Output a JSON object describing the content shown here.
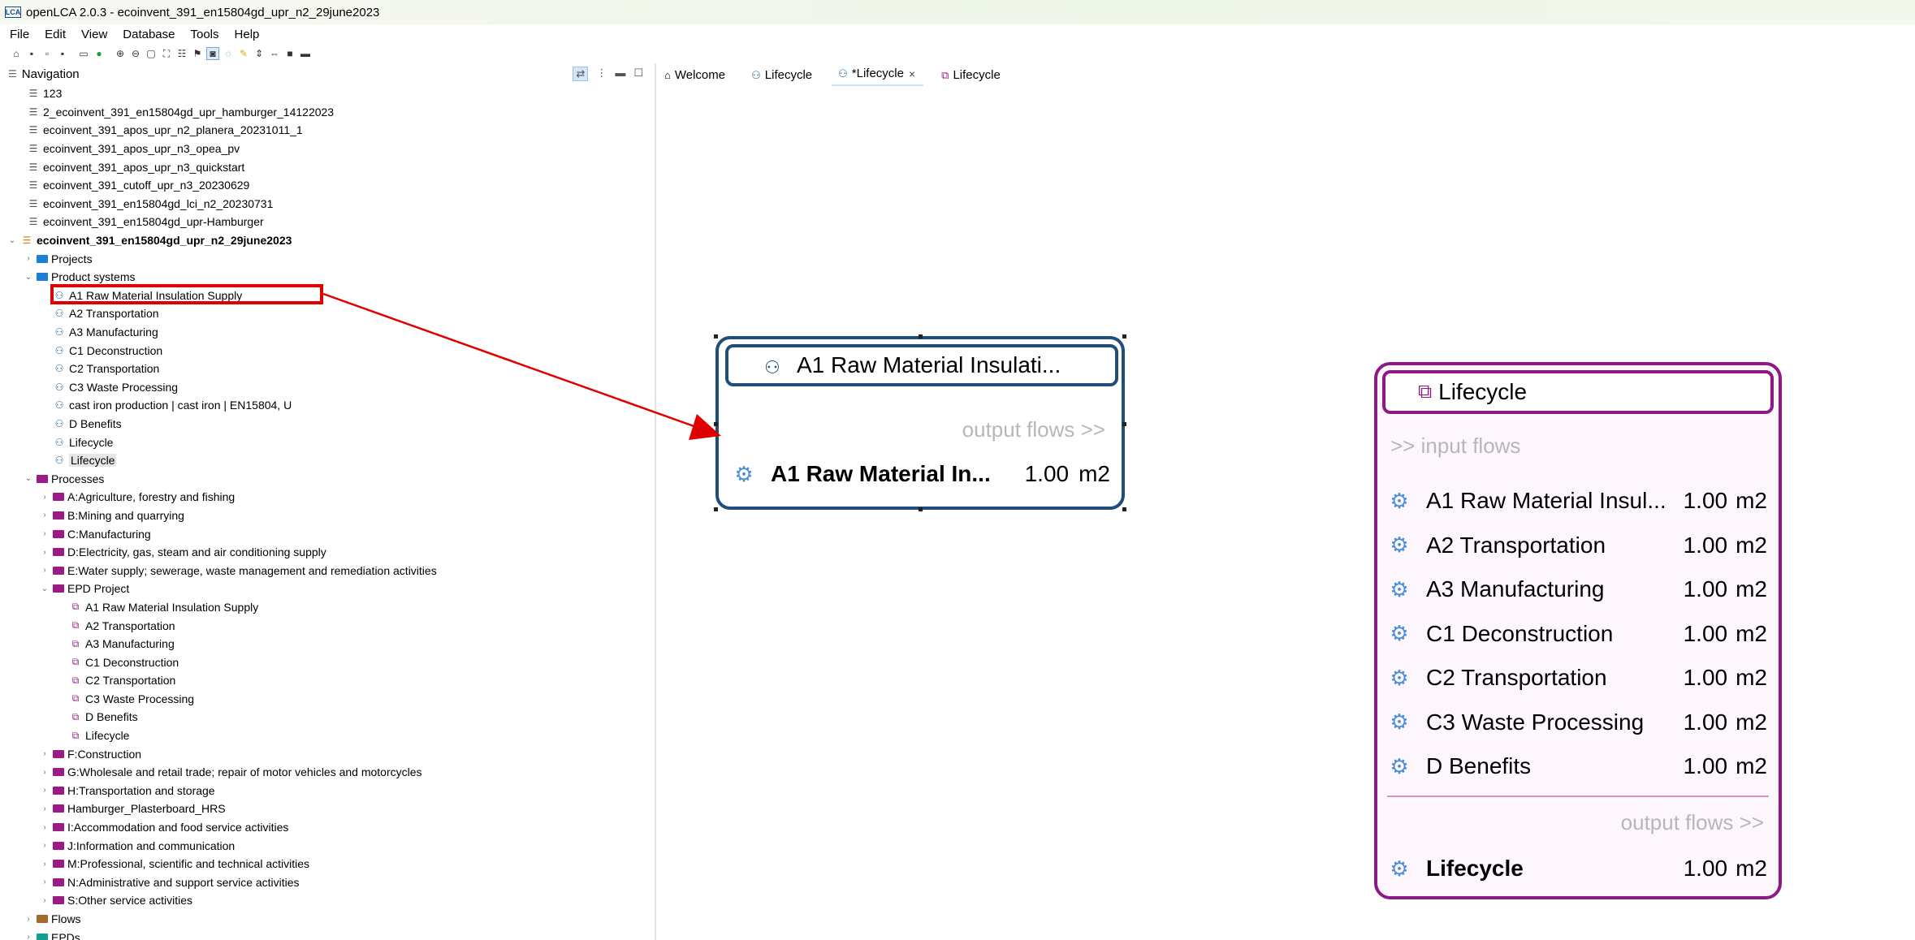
{
  "window": {
    "title": "openLCA 2.0.3 - ecoinvent_391_en15804gd_upr_n2_29june2023",
    "app_icon": "LCA"
  },
  "menu": [
    "File",
    "Edit",
    "View",
    "Database",
    "Tools",
    "Help"
  ],
  "navigation": {
    "header": "Navigation",
    "databases_top": [
      "123",
      "2_ecoinvent_391_en15804gd_upr_hamburger_14122023",
      "ecoinvent_391_apos_upr_n2_planera_20231011_1",
      "ecoinvent_391_apos_upr_n3_opea_pv",
      "ecoinvent_391_apos_upr_n3_quickstart",
      "ecoinvent_391_cutoff_upr_n3_20230629",
      "ecoinvent_391_en15804gd_lci_n2_20230731",
      "ecoinvent_391_en15804gd_upr-Hamburger"
    ],
    "active_db": "ecoinvent_391_en15804gd_upr_n2_29june2023",
    "projects": "Projects",
    "product_systems_label": "Product systems",
    "product_systems": [
      "A1 Raw Material Insulation Supply",
      "A2 Transportation",
      "A3 Manufacturing",
      "C1 Deconstruction",
      "C2 Transportation",
      "C3 Waste Processing",
      "cast iron production | cast iron | EN15804, U",
      "D Benefits",
      "Lifecycle",
      "Lifecycle"
    ],
    "processes_label": "Processes",
    "process_folders_a": [
      "A:Agriculture, forestry and fishing",
      "B:Mining and quarrying",
      "C:Manufacturing",
      "D:Electricity, gas, steam and air conditioning supply",
      "E:Water supply; sewerage, waste management and remediation activities"
    ],
    "epd_folder": "EPD Project",
    "epd_processes": [
      "A1 Raw Material Insulation Supply",
      "A2 Transportation",
      "A3 Manufacturing",
      "C1 Deconstruction",
      "C2 Transportation",
      "C3 Waste Processing",
      "D Benefits",
      "Lifecycle"
    ],
    "process_folders_b": [
      "F:Construction",
      "G:Wholesale and retail trade; repair of motor vehicles and motorcycles",
      "H:Transportation and storage",
      "Hamburger_Plasterboard_HRS",
      "I:Accommodation and food service activities",
      "J:Information and communication",
      "M:Professional, scientific and technical activities",
      "N:Administrative and support service activities",
      "S:Other service activities"
    ],
    "flows": "Flows",
    "epds": "EPDs"
  },
  "tabs": [
    {
      "label": "Welcome",
      "icon": "home-icon"
    },
    {
      "label": "Lifecycle",
      "icon": "product-system-icon"
    },
    {
      "label": "*Lifecycle",
      "icon": "product-system-icon",
      "close": "×"
    },
    {
      "label": "Lifecycle",
      "icon": "process-icon"
    }
  ],
  "node_a1": {
    "title": "A1 Raw Material Insulati...",
    "output_label": "output flows >>",
    "flow_name": "A1 Raw Material In...",
    "flow_amount": "1.00",
    "flow_unit": "m2"
  },
  "node_lifecycle": {
    "title": "Lifecycle",
    "input_label": ">> input flows",
    "inputs": [
      {
        "name": "A1 Raw Material Insul...",
        "amount": "1.00",
        "unit": "m2"
      },
      {
        "name": "A2 Transportation",
        "amount": "1.00",
        "unit": "m2"
      },
      {
        "name": "A3 Manufacturing",
        "amount": "1.00",
        "unit": "m2"
      },
      {
        "name": "C1 Deconstruction",
        "amount": "1.00",
        "unit": "m2"
      },
      {
        "name": "C2 Transportation",
        "amount": "1.00",
        "unit": "m2"
      },
      {
        "name": "C3 Waste Processing",
        "amount": "1.00",
        "unit": "m2"
      },
      {
        "name": "D Benefits",
        "amount": "1.00",
        "unit": "m2"
      }
    ],
    "output_label": "output flows >>",
    "output": {
      "name": "Lifecycle",
      "amount": "1.00",
      "unit": "m2"
    }
  },
  "colors": {
    "product_system": "#1e4e79",
    "process": "#8b1a86",
    "annotation": "#e00000"
  }
}
